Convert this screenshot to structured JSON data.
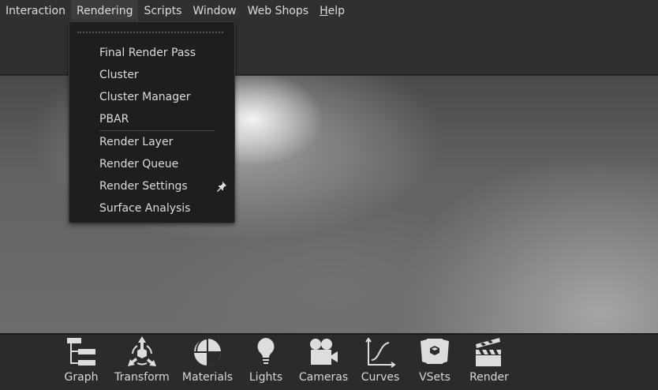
{
  "menubar": {
    "items": [
      "Interaction",
      "Rendering",
      "Scripts",
      "Window",
      "Web Shops",
      "Help"
    ],
    "active": "Rendering"
  },
  "rendering_menu": {
    "items": [
      {
        "label": "Final Render Pass"
      },
      {
        "label": "Cluster"
      },
      {
        "label": "Cluster Manager"
      },
      {
        "label": "PBAR"
      },
      {
        "label": "Render Layer"
      },
      {
        "label": "Render Queue"
      },
      {
        "label": "Render Settings",
        "icon": "pin-icon"
      },
      {
        "label": "Surface Analysis"
      }
    ]
  },
  "toolbar": {
    "items": [
      {
        "label": "Graph",
        "icon": "graph-icon"
      },
      {
        "label": "Transform",
        "icon": "transform-icon"
      },
      {
        "label": "Materials",
        "icon": "materials-icon"
      },
      {
        "label": "Lights",
        "icon": "lightbulb-icon"
      },
      {
        "label": "Cameras",
        "icon": "camera-icon"
      },
      {
        "label": "Curves",
        "icon": "curves-icon"
      },
      {
        "label": "VSets",
        "icon": "vsets-icon"
      },
      {
        "label": "Render",
        "icon": "clapperboard-icon"
      }
    ]
  }
}
